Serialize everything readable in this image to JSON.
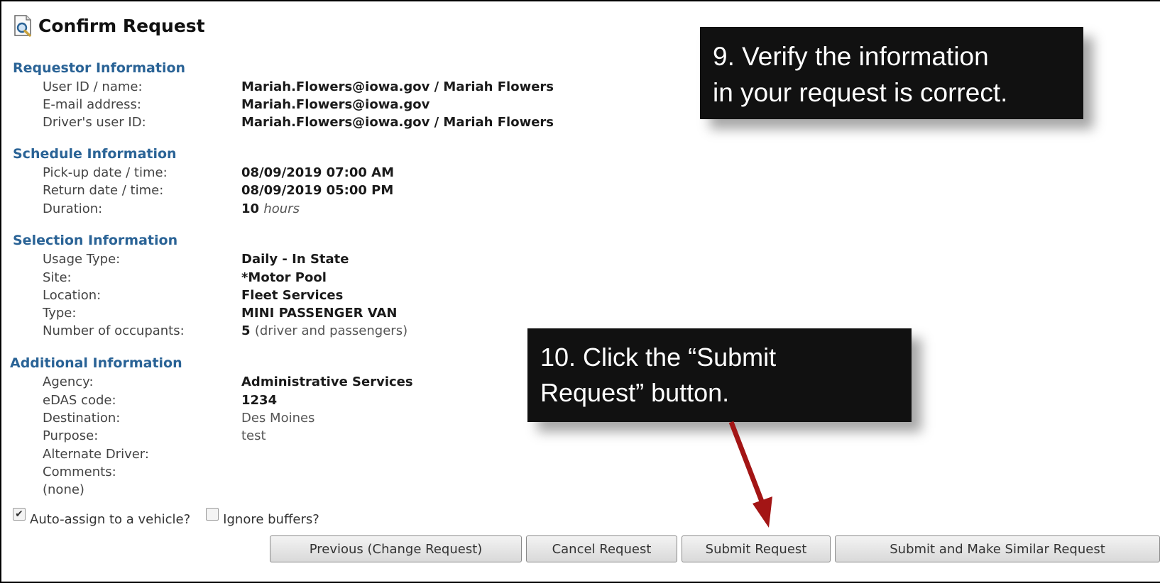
{
  "title": "Confirm Request",
  "sections": {
    "requestor": {
      "heading": "Requestor Information",
      "user_id_label": "User ID / name:",
      "user_id_value": "Mariah.Flowers@iowa.gov / Mariah Flowers",
      "email_label": "E-mail address:",
      "email_value": "Mariah.Flowers@iowa.gov",
      "driver_label": "Driver's user ID:",
      "driver_value": "Mariah.Flowers@iowa.gov / Mariah Flowers"
    },
    "schedule": {
      "heading": "Schedule Information",
      "pickup_label": "Pick-up date / time:",
      "pickup_value": "08/09/2019 07:00 AM",
      "return_label": "Return date / time:",
      "return_value": "08/09/2019 05:00 PM",
      "duration_label": "Duration:",
      "duration_value": "10",
      "duration_unit": "hours"
    },
    "selection": {
      "heading": "Selection Information",
      "usage_label": "Usage Type:",
      "usage_value": "Daily - In State",
      "site_label": "Site:",
      "site_value": "*Motor Pool",
      "location_label": "Location:",
      "location_value": "Fleet Services",
      "type_label": "Type:",
      "type_value": "MINI PASSENGER VAN",
      "occupants_label": "Number of occupants:",
      "occupants_value": "5",
      "occupants_note": "(driver and passengers)"
    },
    "additional": {
      "heading": "Additional Information",
      "agency_label": "Agency:",
      "agency_value": "Administrative Services",
      "edas_label": "eDAS code:",
      "edas_value": "1234",
      "destination_label": "Destination:",
      "destination_value": "Des Moines",
      "purpose_label": "Purpose:",
      "purpose_value": "test",
      "alt_driver_label": "Alternate Driver:",
      "comments_label": "Comments:",
      "comments_value": "(none)"
    }
  },
  "options": {
    "auto_assign_label": "Auto-assign to a vehicle?",
    "auto_assign_checked": true,
    "ignore_buffers_label": "Ignore buffers?",
    "ignore_buffers_checked": false
  },
  "buttons": {
    "previous": "Previous (Change Request)",
    "cancel": "Cancel Request",
    "submit": "Submit Request",
    "submit_similar": "Submit and Make Similar Request"
  },
  "callouts": {
    "verify_line1": "9. Verify the information",
    "verify_line2": "in your request is correct.",
    "click_line1": "10. Click the “Submit",
    "click_line2": "Request” button."
  },
  "colors": {
    "section_heading": "#2a6396",
    "callout_bg": "#111111",
    "arrow": "#a31515"
  }
}
